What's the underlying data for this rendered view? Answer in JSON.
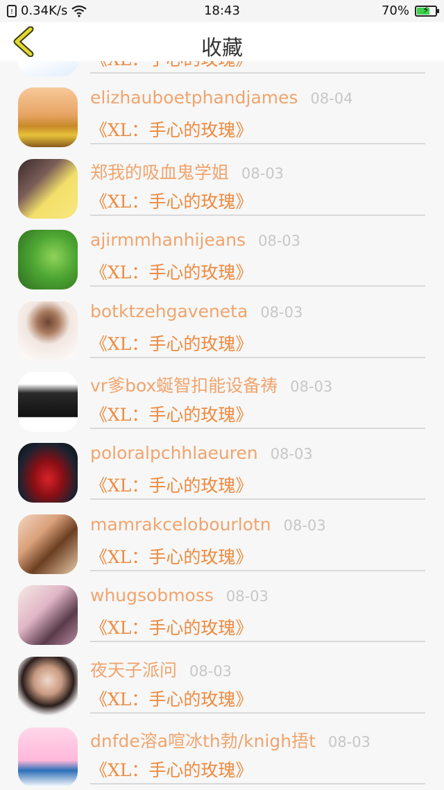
{
  "status_bar": {
    "speed": "0.34K/s",
    "time": "18:43",
    "battery": "70%",
    "battery_level": 0.7
  },
  "header": {
    "title": "收藏"
  },
  "items": [
    {
      "name": "",
      "date": "",
      "book": "《XL：手心的玫瑰》"
    },
    {
      "name": "elizhauboetphandjames",
      "date": "08-04",
      "book": "《XL：手心的玫瑰》"
    },
    {
      "name": "郑我的吸血鬼学姐",
      "date": "08-03",
      "book": "《XL：手心的玫瑰》"
    },
    {
      "name": "ajirmmhanhijeans",
      "date": "08-03",
      "book": "《XL：手心的玫瑰》"
    },
    {
      "name": "botktzehgaveneta",
      "date": "08-03",
      "book": "《XL：手心的玫瑰》"
    },
    {
      "name": "vr爹box蜒智扣能设备祷",
      "date": "08-03",
      "book": "《XL：手心的玫瑰》"
    },
    {
      "name": "poloralpchhlaeuren",
      "date": "08-03",
      "book": "《XL：手心的玫瑰》"
    },
    {
      "name": "mamrakcelobourlotn",
      "date": "08-03",
      "book": "《XL：手心的玫瑰》"
    },
    {
      "name": "whugsobmoss",
      "date": "08-03",
      "book": "《XL：手心的玫瑰》"
    },
    {
      "name": "夜天子派问",
      "date": "08-03",
      "book": "《XL：手心的玫瑰》"
    },
    {
      "name": "dnfde溶a喧冰th勃/knigh捂t",
      "date": "08-03",
      "book": "《XL：手心的玫瑰》"
    }
  ]
}
